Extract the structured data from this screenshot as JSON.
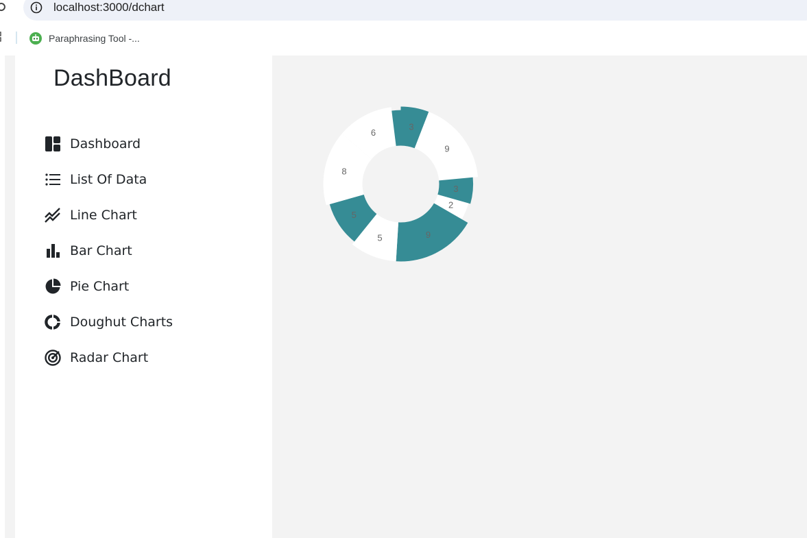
{
  "browser": {
    "url": "localhost:3000/dchart",
    "bookmark_label": "Paraphrasing Tool -..."
  },
  "sidebar": {
    "brand": "DashBoard",
    "items": [
      {
        "label": "Dashboard",
        "icon": "dashboard-icon"
      },
      {
        "label": "List Of Data",
        "icon": "list-icon"
      },
      {
        "label": "Line Chart",
        "icon": "line-chart-icon"
      },
      {
        "label": "Bar Chart",
        "icon": "bar-chart-icon"
      },
      {
        "label": "Pie Chart",
        "icon": "pie-chart-icon"
      },
      {
        "label": "Doughut Charts",
        "icon": "doughnut-chart-icon"
      },
      {
        "label": "Radar Chart",
        "icon": "radar-chart-icon"
      }
    ]
  },
  "colors": {
    "accent": "#368c95",
    "slice_light": "#ffffff",
    "background": "#f3f3f3",
    "label": "#666666"
  },
  "chart_data": {
    "type": "doughnut",
    "values": [
      3,
      9,
      3,
      2,
      9,
      5,
      5,
      8,
      6,
      1
    ],
    "value_labels": [
      "3",
      "9",
      "3",
      "2",
      "9",
      "5",
      "5",
      "8",
      "6",
      ""
    ],
    "colors": [
      "#368c95",
      "#ffffff",
      "#368c95",
      "#ffffff",
      "#368c95",
      "#ffffff",
      "#368c95",
      "#ffffff",
      "#ffffff",
      "#368c95"
    ],
    "radius_scale": [
      1.0,
      1.0,
      0.87,
      0.82,
      1.0,
      1.0,
      0.91,
      1.0,
      1.0,
      0.91
    ]
  }
}
